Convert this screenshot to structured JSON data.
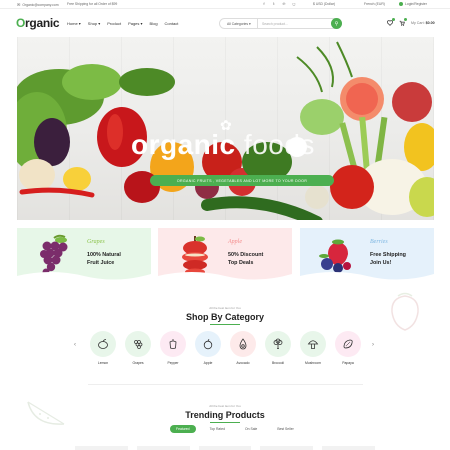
{
  "topbar": {
    "email": "Organic@company.com",
    "shipping": "Free Shipping for all Order of $99",
    "currency": "$ USD (Dollar)",
    "language": "French (EUR)",
    "account": "Login/Register"
  },
  "header": {
    "logo": "rganic",
    "logo_initial": "O",
    "nav": [
      "Home ▾",
      "Shop ▾",
      "Product",
      "Pages ▾",
      "Blog",
      "Contact"
    ],
    "search": {
      "category": "All Categories ▾",
      "placeholder": "Search product..."
    },
    "cart_label": "My Cart:",
    "cart_total": "$0.00"
  },
  "hero": {
    "title_bold": "organic",
    "title_light": "foods",
    "pill": "ORGANIC FRUITS , VEGETABLES AND LOT MORE TO YOUR DOOR"
  },
  "promos": [
    {
      "title": "Grapes",
      "line1": "100% Natural",
      "line2": "Fruit Juice",
      "bg": "#e7f7e8",
      "title_color": "#8bc34a"
    },
    {
      "title": "Apple",
      "line1": "50% Discount",
      "line2": "Top Deals",
      "bg": "#fde9ea",
      "title_color": "#f48b8b"
    },
    {
      "title": "Berries",
      "line1": "Free Shipping",
      "line2": "Join Us!",
      "bg": "#e5f1fb",
      "title_color": "#7eb7e2"
    }
  ],
  "category": {
    "subtitle": "All the best item for You",
    "title": "Shop By Category",
    "items": [
      {
        "label": "Lemon",
        "icon": "lemon-icon",
        "bg": "#e8f6ea"
      },
      {
        "label": "Grapes",
        "icon": "grapes-icon",
        "bg": "#e8f6ea"
      },
      {
        "label": "Pepper",
        "icon": "pepper-icon",
        "bg": "#fdeaf3"
      },
      {
        "label": "Apple",
        "icon": "apple-icon",
        "bg": "#e6f2fb"
      },
      {
        "label": "Avocado",
        "icon": "avocado-icon",
        "bg": "#fdeaea"
      },
      {
        "label": "Broccoli",
        "icon": "broccoli-icon",
        "bg": "#e8f6ea"
      },
      {
        "label": "Mushroom",
        "icon": "mushroom-icon",
        "bg": "#e8f6ea"
      },
      {
        "label": "Papaya",
        "icon": "papaya-icon",
        "bg": "#fdeaf3"
      }
    ]
  },
  "trending": {
    "subtitle": "All the best item for You",
    "title": "Trending Products",
    "tabs": [
      "Featured",
      "Top Rated",
      "On Sale",
      "Best Seller"
    ]
  },
  "colors": {
    "accent": "#4caf50"
  }
}
